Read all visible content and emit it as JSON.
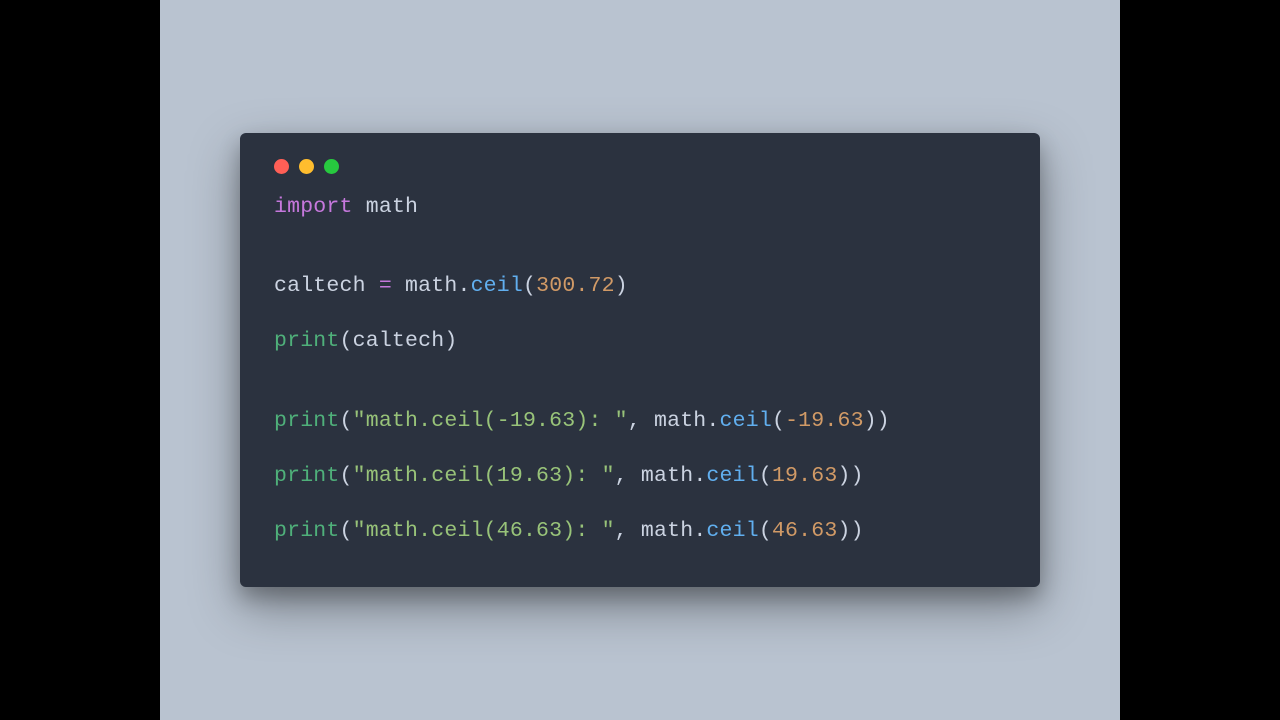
{
  "code": {
    "import_kw": "import",
    "import_mod": "math",
    "assign": {
      "var": "caltech",
      "eq": "=",
      "obj": "math",
      "dot": ".",
      "method": "ceil",
      "lp": "(",
      "arg": "300.72",
      "rp": ")"
    },
    "print1": {
      "fn": "print",
      "lp": "(",
      "arg": "caltech",
      "rp": ")"
    },
    "prints": [
      {
        "fn": "print",
        "str": "\"math.ceil(-19.63): \"",
        "comma": ", ",
        "obj": "math",
        "dot": ".",
        "method": "ceil",
        "num": "-19.63"
      },
      {
        "fn": "print",
        "str": "\"math.ceil(19.63): \"",
        "comma": ", ",
        "obj": "math",
        "dot": ".",
        "method": "ceil",
        "num": "19.63"
      },
      {
        "fn": "print",
        "str": "\"math.ceil(46.63): \"",
        "comma": ", ",
        "obj": "math",
        "dot": ".",
        "method": "ceil",
        "num": "46.63"
      }
    ]
  },
  "colors": {
    "bg_stage": "#b9c3d0",
    "bg_window": "#2b323f",
    "red": "#ff5f56",
    "yellow": "#ffbd2e",
    "green": "#27c93f"
  }
}
